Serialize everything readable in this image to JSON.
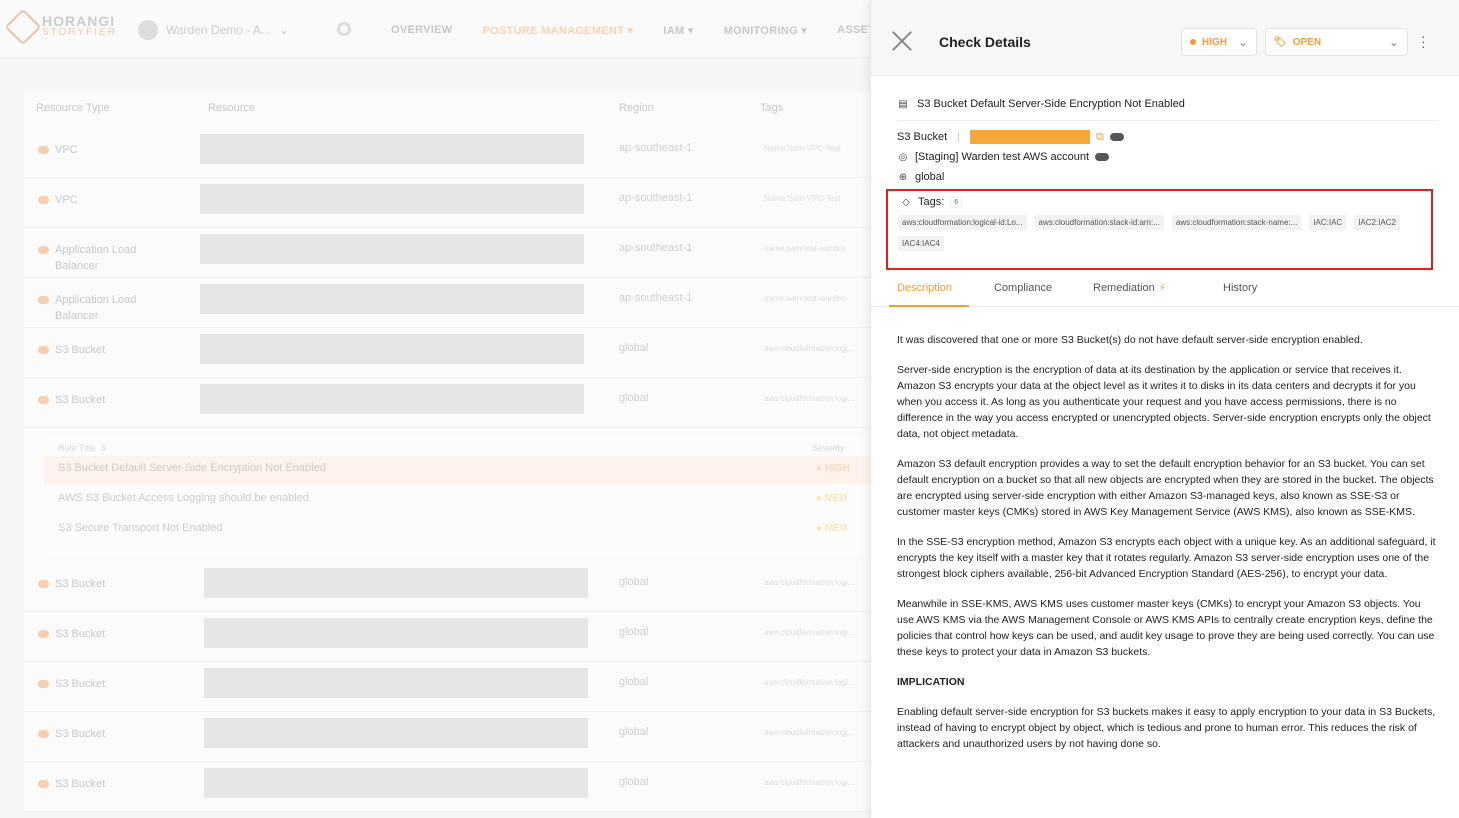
{
  "topbar": {
    "logo_main": "HORANGI",
    "logo_sub": "STORYFIER",
    "workspace": "Warden Demo - A...",
    "nav": [
      "OVERVIEW",
      "POSTURE MANAGEMENT",
      "IAM",
      "MONITORING",
      "ASSET INVE"
    ]
  },
  "table": {
    "headers": [
      "Resource Type",
      "Resource",
      "Region",
      "Tags"
    ],
    "rows_top": [
      {
        "type": "VPC",
        "region": "ap-southeast-1",
        "tag": "Name:Sam-VPC-Test"
      },
      {
        "type": "VPC",
        "region": "ap-southeast-1",
        "tag": "Name:Sam-VPC-Test"
      },
      {
        "type": "Application Load Balancer",
        "region": "ap-southeast-1",
        "tag": "name:sam-test-warden"
      },
      {
        "type": "Application Load Balancer",
        "region": "ap-southeast-1",
        "tag": "name:sam-test-warden"
      },
      {
        "type": "S3 Bucket",
        "region": "global",
        "tag": "aws:cloudformation:logi..."
      },
      {
        "type": "S3 Bucket",
        "region": "global",
        "tag": "aws:cloudformation:logi..."
      }
    ],
    "rules_header": "Rule Title",
    "rules_count": "3",
    "severity_header": "Severity",
    "rules": [
      {
        "title": "S3 Bucket Default Server-Side Encryption Not Enabled",
        "severity": "HIGH"
      },
      {
        "title": "AWS S3 Bucket Access Logging should be enabled",
        "severity": "MED"
      },
      {
        "title": "S3 Secure Transport Not Enabled",
        "severity": "MED"
      }
    ],
    "rows_bottom": [
      {
        "type": "S3 Bucket",
        "region": "global",
        "tag": "aws:cloudformation:logi..."
      },
      {
        "type": "S3 Bucket",
        "region": "global",
        "tag": "aws:cloudformation:logi..."
      },
      {
        "type": "S3 Bucket",
        "region": "global",
        "tag": "aws:cloudformation:logi..."
      },
      {
        "type": "S3 Bucket",
        "region": "global",
        "tag": "aws:cloudformation:logi..."
      },
      {
        "type": "S3 Bucket",
        "region": "global",
        "tag": "aws:cloudformation:logi..."
      }
    ]
  },
  "panel": {
    "title": "Check Details",
    "severity": "HIGH",
    "status": "OPEN",
    "check_title": "S3 Bucket Default Server-Side Encryption Not Enabled",
    "resource_type": "S3 Bucket",
    "account": "[Staging] Warden test AWS account",
    "region": "global",
    "tags_label": "Tags:",
    "tags_count": "6",
    "tags": [
      "aws:cloudformation:logical-id:Lo...",
      "aws:cloudformation:stack-id:arn:...",
      "aws:cloudformation:stack-name:...",
      "IAC:IAC",
      "IAC2:IAC2",
      "IAC4:IAC4"
    ],
    "tabs": [
      "Description",
      "Compliance",
      "Remediation",
      "History"
    ],
    "description": [
      "It was discovered that one or more S3 Bucket(s) do not have default server-side encryption enabled.",
      "Server-side encryption is the encryption of data at its destination by the application or service that receives it. Amazon S3 encrypts your data at the object level as it writes it to disks in its data centers and decrypts it for you when you access it. As long as you authenticate your request and you have access permissions, there is no difference in the way you access encrypted or unencrypted objects. Server-side encryption encrypts only the object data, not object metadata.",
      "Amazon S3 default encryption provides a way to set the default encryption behavior for an S3 bucket. You can set default encryption on a bucket so that all new objects are encrypted when they are stored in the bucket. The objects are encrypted using server-side encryption with either Amazon S3-managed keys, also known as SSE-S3 or customer master keys (CMKs) stored in AWS Key Management Service (AWS KMS), also known as SSE-KMS.",
      "In the SSE-S3 encryption method, Amazon S3 encrypts each object with a unique key. As an additional safeguard, it encrypts the key itself with a master key that it rotates regularly. Amazon S3 server-side encryption uses one of the strongest block ciphers available, 256-bit Advanced Encryption Standard (AES-256), to encrypt your data.",
      "Meanwhile in SSE-KMS, AWS KMS uses customer master keys (CMKs) to encrypt your Amazon S3 objects. You use AWS KMS via the AWS Management Console or AWS KMS APIs to centrally create encryption keys, define the policies that control how keys can be used, and audit key usage to prove they are being used correctly. You can use these keys to protect your data in Amazon S3 buckets."
    ],
    "implication_heading": "IMPLICATION",
    "implication": "Enabling default server-side encryption for S3 buckets makes it easy to apply encryption to your data in S3 Buckets, instead of having to encrypt object by object, which is tedious and prone to human error. This reduces the risk of attackers and unauthorized users by not having done so."
  }
}
